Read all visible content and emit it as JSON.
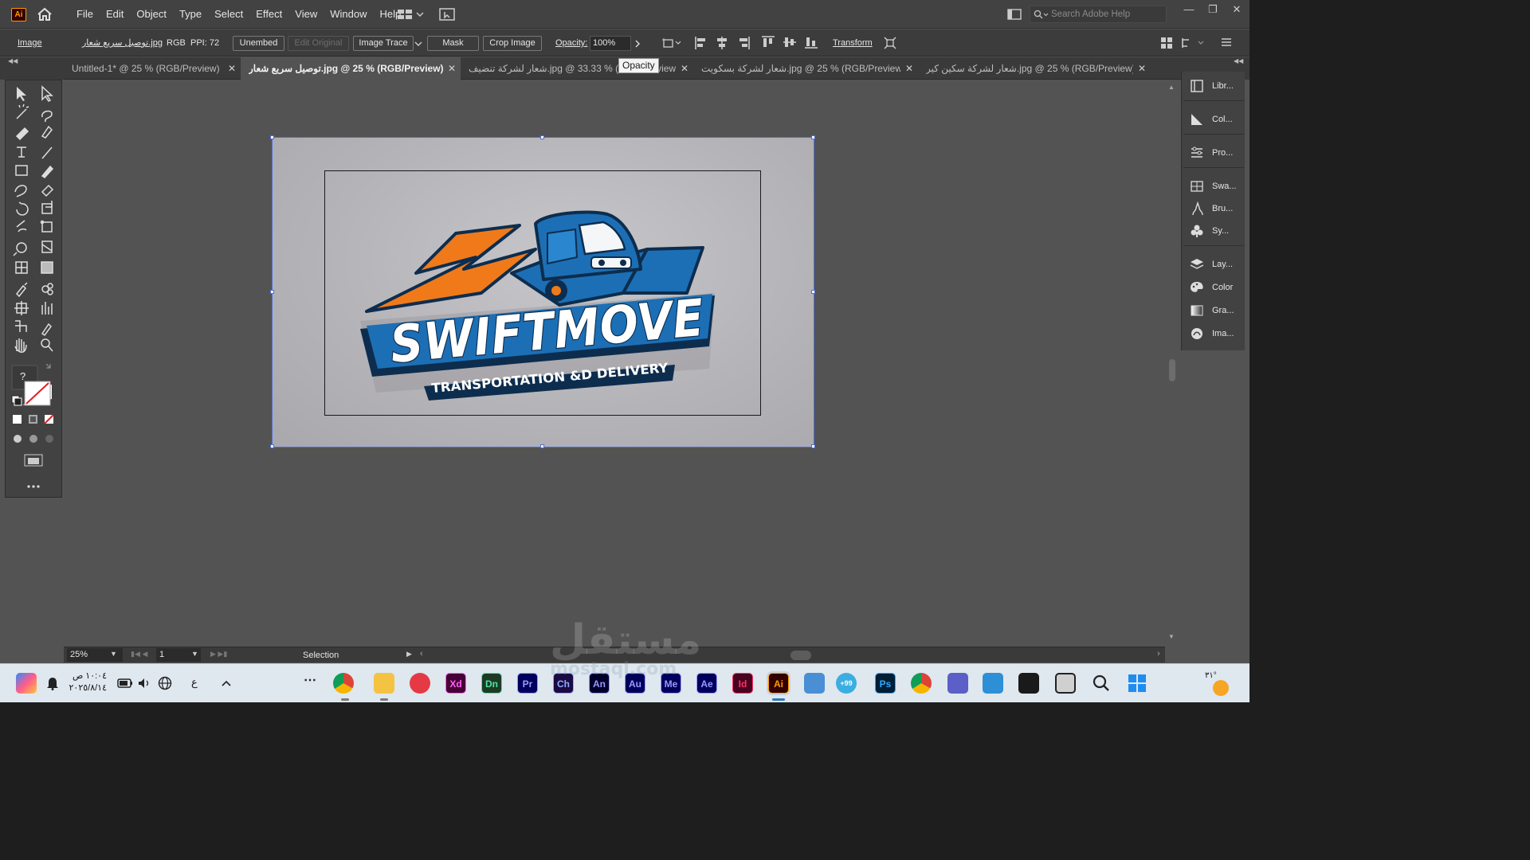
{
  "app": {
    "logo": "Ai",
    "accent": "#ff9a00"
  },
  "menu": [
    "File",
    "Edit",
    "Object",
    "Type",
    "Select",
    "Effect",
    "View",
    "Window",
    "Help"
  ],
  "search": {
    "placeholder": "Search Adobe Help"
  },
  "control_bar": {
    "object_type": "Image",
    "filename": "توصيل سريع شعار.jpg",
    "color_mode": "RGB",
    "ppi": "PPI: 72",
    "unembed": "Unembed",
    "edit_original": "Edit Original",
    "image_trace": "Image Trace",
    "mask": "Mask",
    "crop_image": "Crop Image",
    "opacity_label": "Opacity:",
    "opacity_value": "100%",
    "transform": "Transform"
  },
  "tooltip": "Opacity",
  "tabs": [
    {
      "label": "Untitled-1* @ 25 % (RGB/Preview)",
      "active": false
    },
    {
      "label": "توصيل سريع شعار.jpg @ 25 % (RGB/Preview)",
      "active": true
    },
    {
      "label": "شعار لشركة تنضيف.jpg @ 33.33 % (RGB/Preview)",
      "active": false
    },
    {
      "label": "شعار لشركة بسكويت.jpg @ 25 % (RGB/Preview)",
      "active": false
    },
    {
      "label": "شعار لشركة سكين كير.jpg @ 25 % (RGB/Preview)",
      "active": false
    }
  ],
  "tool_color_help": "?",
  "dock": [
    {
      "label": "Libr...",
      "icon": "libraries-icon"
    },
    {
      "label": "Col...",
      "icon": "color-guide-icon"
    },
    {
      "label": "Pro...",
      "icon": "properties-icon"
    },
    {
      "label": "Swa...",
      "icon": "swatches-icon"
    },
    {
      "label": "Bru...",
      "icon": "brushes-icon"
    },
    {
      "label": "Sy...",
      "icon": "symbols-icon"
    },
    {
      "label": "Lay...",
      "icon": "layers-icon"
    },
    {
      "label": "Color",
      "icon": "color-icon"
    },
    {
      "label": "Gra...",
      "icon": "gradient-icon"
    },
    {
      "label": "Ima...",
      "icon": "image-trace-icon"
    }
  ],
  "logo_image": {
    "brand": "SWIFTMOVE",
    "tagline": "TRANSPORTATION &D DELIVERY",
    "colors": {
      "orange": "#f07a1a",
      "blue": "#1c6fb5",
      "navy": "#0d2d4e"
    }
  },
  "status_bar": {
    "zoom": "25%",
    "artboard": "1",
    "tool": "Selection"
  },
  "watermark": {
    "text": "مستقل",
    "sub": "mostaql.com"
  },
  "taskbar": {
    "time": "١٠:٠٤ ص",
    "date": "٢٠٢٥/٨/١٤",
    "lang": "ع",
    "badge": "+99",
    "weather": "٣١°",
    "apps": [
      {
        "label": "Xd",
        "bg": "#470137",
        "fg": "#ff61f6"
      },
      {
        "label": "Dn",
        "bg": "#1d3a24",
        "fg": "#4ee2a3"
      },
      {
        "label": "Pr",
        "bg": "#00005b",
        "fg": "#9999ff"
      },
      {
        "label": "Ch",
        "bg": "#1b0b42",
        "fg": "#8fa8ff"
      },
      {
        "label": "An",
        "bg": "#01002b",
        "fg": "#9999ff"
      },
      {
        "label": "Au",
        "bg": "#00005b",
        "fg": "#9999ff"
      },
      {
        "label": "Me",
        "bg": "#00005b",
        "fg": "#9999ff"
      },
      {
        "label": "Ae",
        "bg": "#00005b",
        "fg": "#9999ff"
      },
      {
        "label": "Id",
        "bg": "#49021f",
        "fg": "#ff3366"
      },
      {
        "label": "Ai",
        "bg": "#330000",
        "fg": "#ff9a00"
      },
      {
        "label": "Ps",
        "bg": "#001e36",
        "fg": "#31a8ff"
      }
    ]
  }
}
